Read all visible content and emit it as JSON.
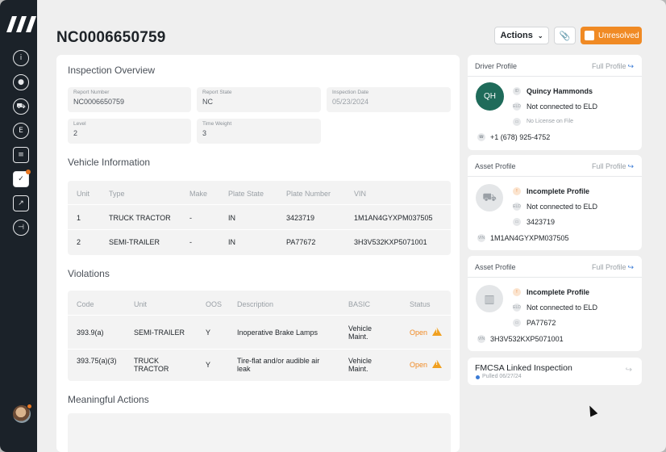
{
  "report_title": "NC0006650759",
  "header": {
    "actions_label": "Actions",
    "status_label": "Unresolved"
  },
  "overview": {
    "heading": "Inspection Overview",
    "fields": [
      {
        "label": "Report Number",
        "value": "NC0006650759"
      },
      {
        "label": "Report State",
        "value": "NC"
      },
      {
        "label": "Inspection Date",
        "value": "05/23/2024"
      },
      {
        "label": "Level",
        "value": "2"
      },
      {
        "label": "Time Weight",
        "value": "3"
      }
    ]
  },
  "vehicles": {
    "heading": "Vehicle Information",
    "columns": [
      "Unit",
      "Type",
      "Make",
      "Plate State",
      "Plate Number",
      "VIN"
    ],
    "rows": [
      [
        "1",
        "TRUCK TRACTOR",
        "-",
        "IN",
        "3423719",
        "1M1AN4GYXPM037505"
      ],
      [
        "2",
        "SEMI-TRAILER",
        "-",
        "IN",
        "PA77672",
        "3H3V532KXP5071001"
      ]
    ]
  },
  "violations": {
    "heading": "Violations",
    "columns": [
      "Code",
      "Unit",
      "OOS",
      "Description",
      "BASIC",
      "Status"
    ],
    "rows": [
      {
        "code": "393.9(a)",
        "unit": "SEMI-TRAILER",
        "oos": "Y",
        "description": "Inoperative Brake Lamps",
        "basic": "Vehicle Maint.",
        "status": "Open"
      },
      {
        "code": "393.75(a)(3)",
        "unit": "TRUCK TRACTOR",
        "oos": "Y",
        "description": "Tire-flat and/or audible air leak",
        "basic": "Vehicle Maint.",
        "status": "Open"
      }
    ]
  },
  "meaningful_actions": {
    "heading": "Meaningful Actions"
  },
  "driver": {
    "heading": "Driver Profile",
    "full_profile": "Full Profile",
    "initials": "QH",
    "name": "Quincy Hammonds",
    "eld_status": "Not connected to ELD",
    "license": "No License on File",
    "phone": "+1 (678) 925-4752"
  },
  "assets": [
    {
      "heading": "Asset Profile",
      "full_profile": "Full Profile",
      "status": "Incomplete Profile",
      "eld_status": "Not connected to ELD",
      "number": "3423719",
      "vin": "1M1AN4GYXPM037505"
    },
    {
      "heading": "Asset Profile",
      "full_profile": "Full Profile",
      "status": "Incomplete Profile",
      "eld_status": "Not connected to ELD",
      "number": "PA77672",
      "vin": "3H3V532KXP5071001"
    }
  ],
  "fmcsa": {
    "title": "FMCSA Linked Inspection",
    "pulled": "Pulled 06/27/24"
  },
  "colors": {
    "accent": "#f08a24",
    "sidebar": "#1b2229",
    "driver_avatar": "#1f6b5a",
    "link": "#3a7bd5"
  }
}
